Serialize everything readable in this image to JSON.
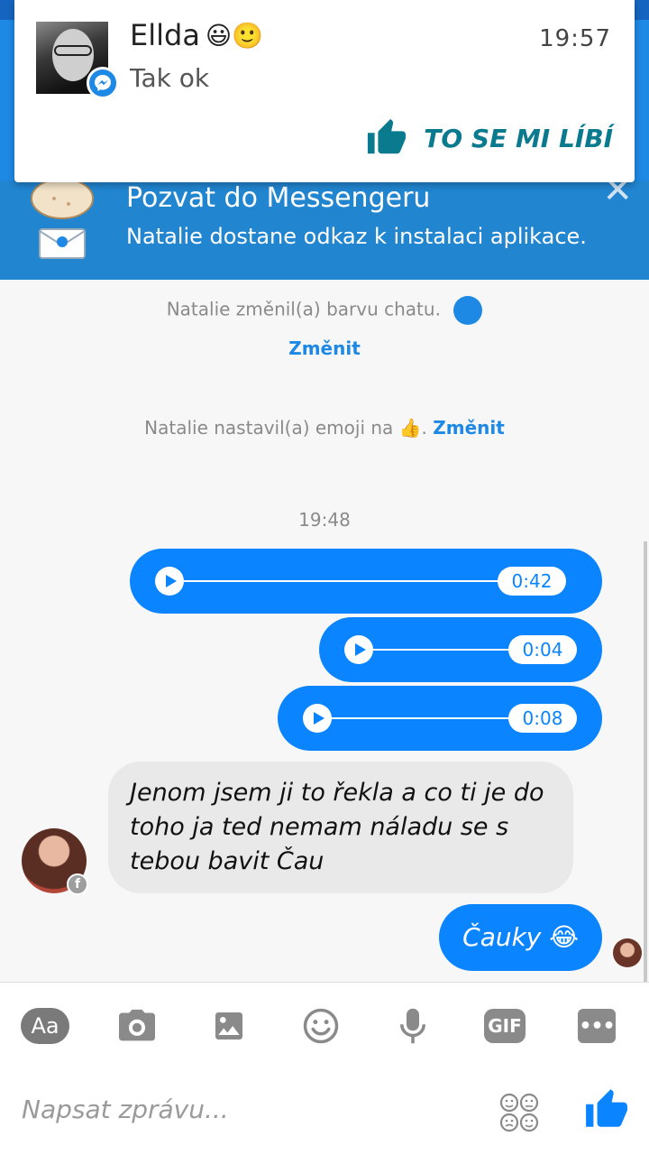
{
  "notification": {
    "sender": "Ellda",
    "sender_emojis": "😃🙂",
    "message": "Tak ok",
    "time": "19:57",
    "action_label": "TO SE MI LÍBÍ"
  },
  "invite_banner": {
    "title": "Pozvat do Messengeru",
    "subtitle": "Natalie dostane odkaz k instalaci aplikace.",
    "close": "✕"
  },
  "chat": {
    "color_change_text": "Natalie změnil(a) barvu chatu.",
    "color_change_link": "Změnit",
    "emoji_change_text": "Natalie nastavil(a) emoji na 👍.",
    "emoji_change_link": "Změnit",
    "timestamp": "19:48",
    "voice_messages": [
      {
        "duration": "0:42"
      },
      {
        "duration": "0:04"
      },
      {
        "duration": "0:08"
      }
    ],
    "incoming_text": "Jenom jsem ji to řekla a co ti je do toho ja ted nemam náladu se s tebou bavit Čau",
    "outgoing_text": "Čauky 😂",
    "accent_color": "#0a84ff"
  },
  "composer": {
    "aa_label": "Aa",
    "gif_label": "GIF",
    "more_label": "•••",
    "placeholder": "Napsat zprávu..."
  }
}
